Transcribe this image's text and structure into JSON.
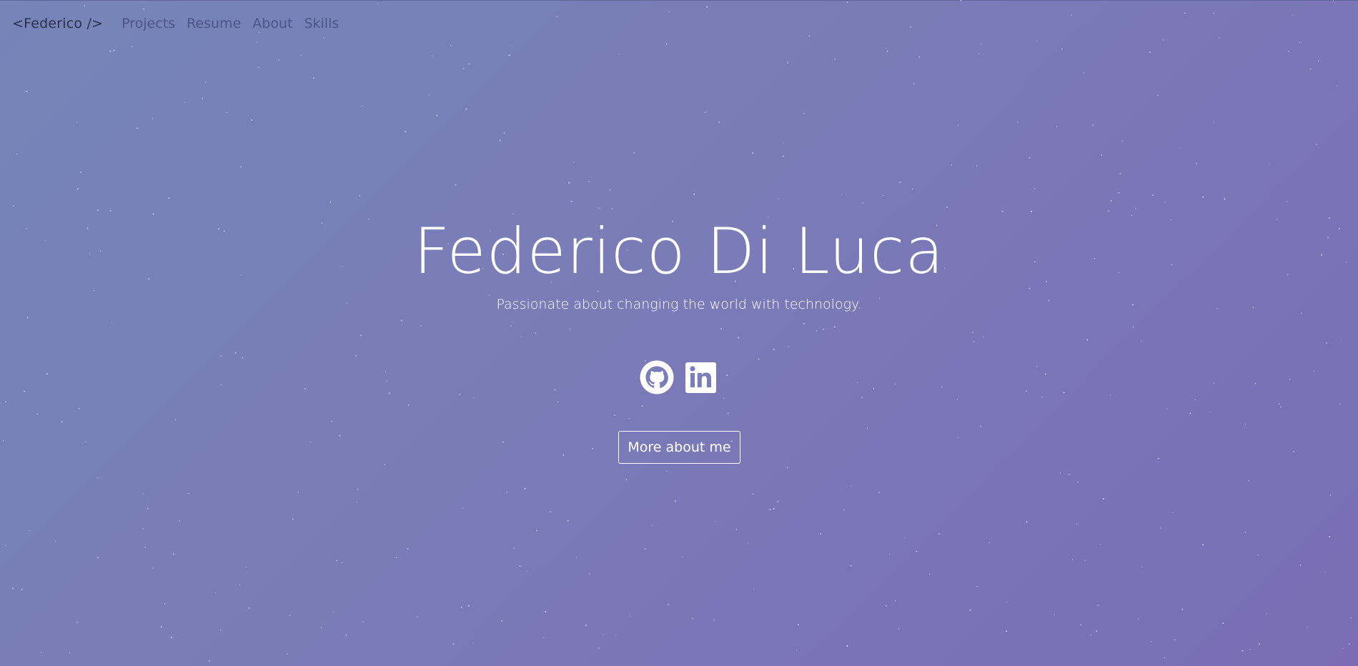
{
  "nav": {
    "brand": "<Federico />",
    "links": [
      "Projects",
      "Resume",
      "About",
      "Skills"
    ]
  },
  "hero": {
    "title": "Federico Di Luca",
    "subtitle": "Passionate about changing the world with technology.",
    "cta_label": "More about me"
  },
  "socials": [
    {
      "icon": "github-icon"
    },
    {
      "icon": "linkedin-icon"
    }
  ],
  "colors": {
    "background_start": "#7585b8",
    "background_end": "#7a6db5",
    "text": "#ffffff",
    "brand": "#2c2f4a",
    "nav_link": "#4d5586"
  }
}
